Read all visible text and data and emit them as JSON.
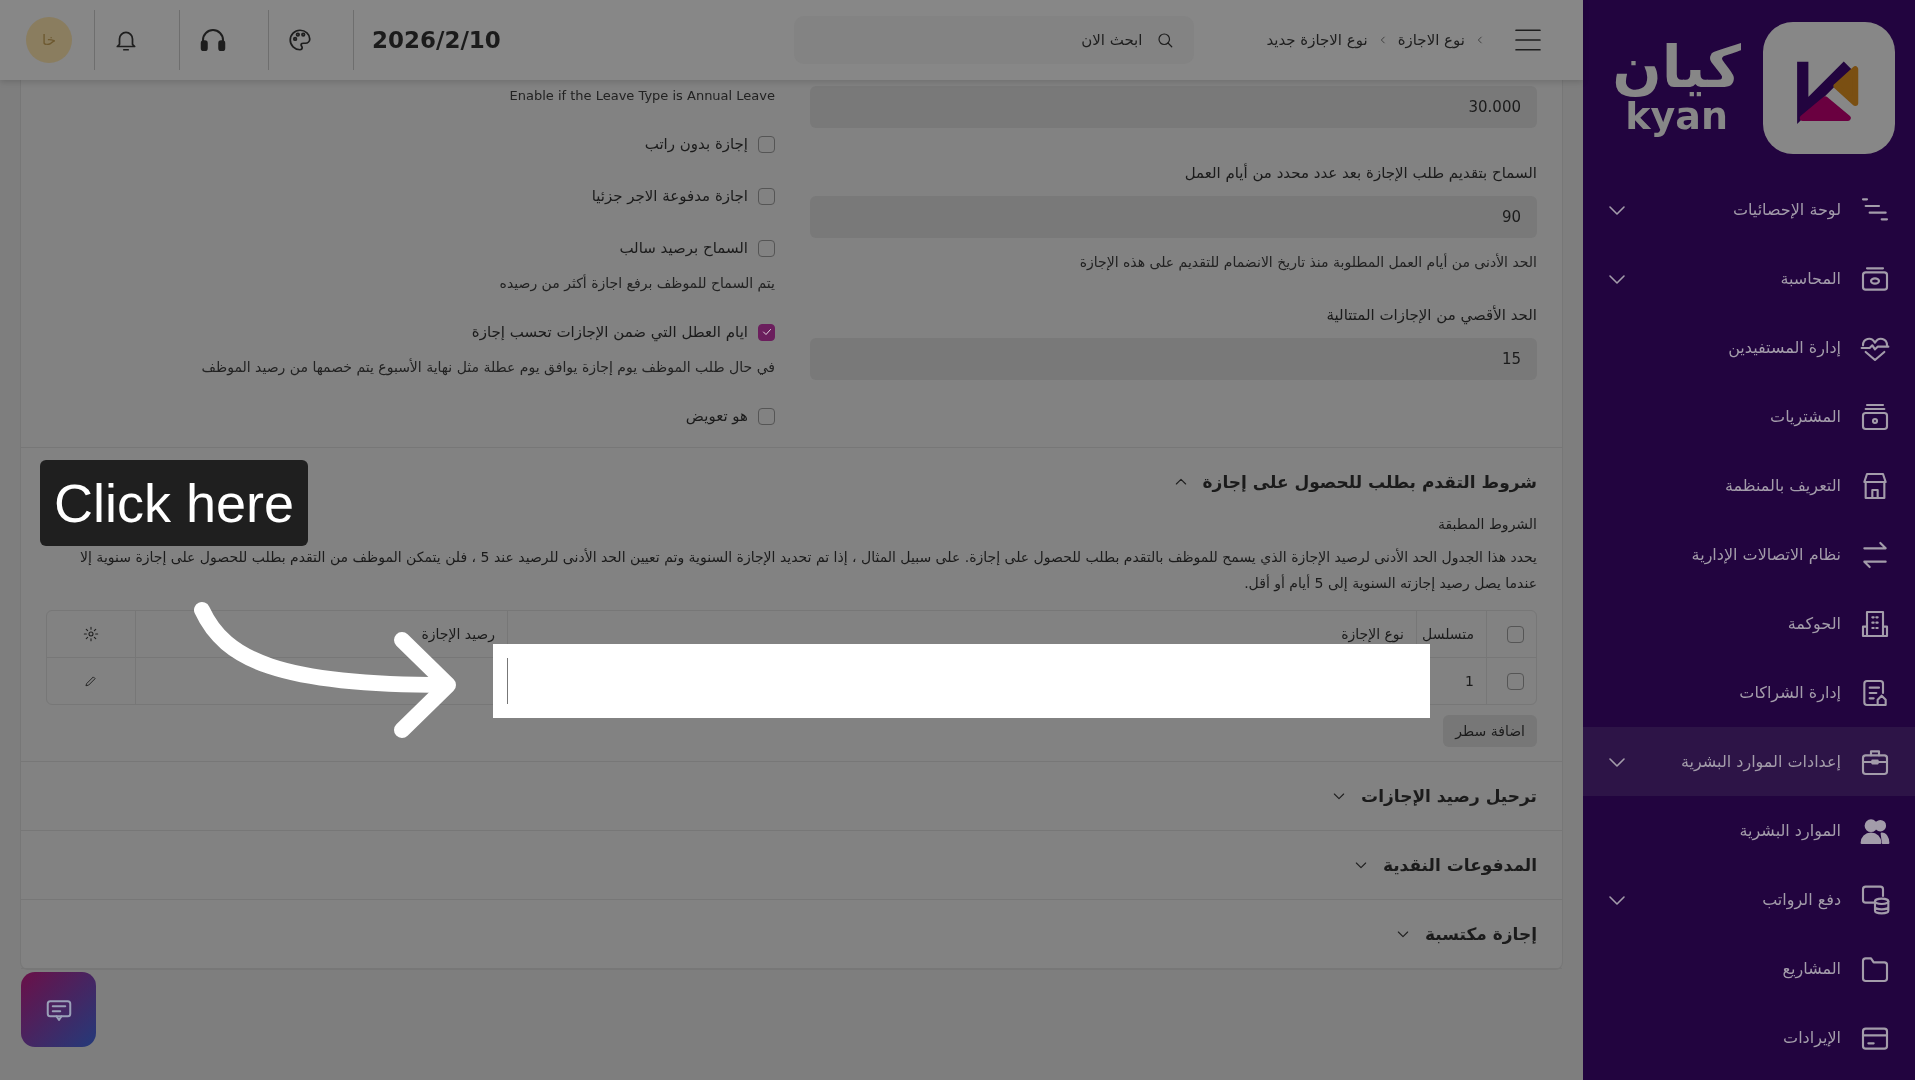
{
  "top_bar": {
    "breadcrumb": [
      {
        "label": "نوع الاجازة"
      },
      {
        "label": "نوع الاجازة جديد"
      }
    ],
    "search": {
      "placeholder": "ابحث الان"
    },
    "date": "2026/2/10",
    "avatar": "خا"
  },
  "form": {
    "right_column": [
      {
        "kind": "input",
        "value": "30.000"
      },
      {
        "kind": "label",
        "text": "السماح بتقديم طلب الإجازة بعد عدد محدد من أيام العمل"
      },
      {
        "kind": "input",
        "value": "90"
      },
      {
        "kind": "hint",
        "text": "الحد الأدنى من أيام العمل المطلوبة منذ تاريخ الانضمام للتقديم على هذه الإجازة"
      },
      {
        "kind": "label",
        "text": "الحد الأقصي من الإجازات المتتالية"
      },
      {
        "kind": "input",
        "value": "15"
      }
    ],
    "left_column": [
      {
        "kind": "hint",
        "text": "Enable if the Leave Type is Annual Leave"
      },
      {
        "kind": "checkbox",
        "text": "إجازة بدون راتب",
        "checked": false
      },
      {
        "kind": "checkbox",
        "text": "اجازة مدفوعة الاجر جزئيا",
        "checked": false
      },
      {
        "kind": "checkbox",
        "text": "السماح برصيد سالب",
        "checked": false
      },
      {
        "kind": "hint",
        "text": "يتم السماح للموظف برفع اجازة أكثر من رصيده"
      },
      {
        "kind": "checkbox",
        "text": "ايام العطل التي ضمن الإجازات تحسب إجازة",
        "checked": true
      },
      {
        "kind": "hint",
        "text": "في حال طلب الموظف يوم إجازة يوافق يوم عطلة مثل نهاية الأسبوع يتم خصمها من رصيد الموظف"
      },
      {
        "kind": "checkbox",
        "text": "هو تعويض",
        "checked": false
      }
    ]
  },
  "sections": [
    {
      "title": "شروط التقدم بطلب للحصول على إجازة",
      "expanded": true,
      "subtitle": "الشروط المطبقة",
      "description": "يحدد هذا الجدول الحد الأدنى لرصيد الإجازة الذي يسمح للموظف بالتقدم بطلب للحصول على إجازة. على سبيل المثال ، إذا تم تحديد الإجازة السنوية وتم تعيين الحد الأدنى للرصيد عند 5 ، فلن يتمكن الموظف من التقدم بطلب للحصول على إجازة سنوية إلا عندما يصل رصيد إجازته السنوية إلى 5 أيام أو أقل.",
      "table": {
        "all_selected": false,
        "columns": [
          "متسلسل",
          "نوع الإجازة",
          "رصيد الإجازة"
        ],
        "rows": [
          {
            "selected": false,
            "cells": [
              {
                "text": "1",
                "highlighted": false
              },
              {
                "highlighted": true
              },
              {
                "highlighted": false
              }
            ]
          }
        ]
      },
      "add_row_button": "اضافة سطر"
    },
    {
      "title": "ترحيل رصيد الإجازات",
      "expanded": false
    },
    {
      "title": "المدفوعات النقدية",
      "expanded": false
    },
    {
      "title": "إجازة مكتسبة",
      "expanded": false
    }
  ],
  "tour": {
    "tooltip": "Click here"
  },
  "sidebar": {
    "logo": {
      "arabic": "كيان",
      "latin": "kyan"
    },
    "items": [
      {
        "label": "لوحة الإحصائيات",
        "expandable": true,
        "selected": false
      },
      {
        "label": "المحاسبة",
        "expandable": true,
        "selected": false
      },
      {
        "label": "إدارة المستفيدين",
        "expandable": false,
        "selected": false
      },
      {
        "label": "المشتريات",
        "expandable": false,
        "selected": false
      },
      {
        "label": "التعريف بالمنظمة",
        "expandable": false,
        "selected": false
      },
      {
        "label": "نظام الاتصالات الإدارية",
        "expandable": false,
        "selected": false
      },
      {
        "label": "الحوكمة",
        "expandable": false,
        "selected": false
      },
      {
        "label": "إدارة الشراكات",
        "expandable": false,
        "selected": false
      },
      {
        "label": "إعدادات الموارد البشرية",
        "expandable": true,
        "selected": true
      },
      {
        "label": "الموارد البشرية",
        "expandable": false,
        "selected": false
      },
      {
        "label": "دفع الرواتب",
        "expandable": true,
        "selected": false
      },
      {
        "label": "المشاريع",
        "expandable": false,
        "selected": false
      },
      {
        "label": "الإيرادات",
        "expandable": false,
        "selected": false
      }
    ]
  }
}
